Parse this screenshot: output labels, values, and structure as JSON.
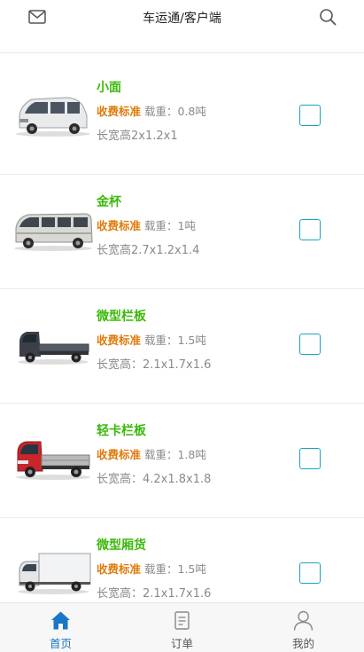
{
  "header": {
    "title": "车运通/客户端",
    "left_icon": "mail-icon",
    "right_icon": "search-icon"
  },
  "vehicles": [
    {
      "name": "小面",
      "fee_label": "收费标准",
      "load": "载重：0.8吨",
      "dims": "长宽高2x1.2x1"
    },
    {
      "name": "金杯",
      "fee_label": "收费标准",
      "load": "载重：1吨",
      "dims": "长宽高2.7x1.2x1.4"
    },
    {
      "name": "微型栏板",
      "fee_label": "收费标准",
      "load": "载重：1.5吨",
      "dims": "长宽高：2.1x1.7x1.6"
    },
    {
      "name": "轻卡栏板",
      "fee_label": "收费标准",
      "load": "载重：1.8吨",
      "dims": "长宽高：4.2x1.8x1.8"
    },
    {
      "name": "微型厢货",
      "fee_label": "收费标准",
      "load": "载重：1.5吨",
      "dims": "长宽高：2.1x1.7x1.6"
    }
  ],
  "tabs": [
    {
      "label": "首页",
      "icon": "home-icon",
      "active": true
    },
    {
      "label": "订单",
      "icon": "order-icon",
      "active": false
    },
    {
      "label": "我的",
      "icon": "user-icon",
      "active": false
    }
  ],
  "colors": {
    "accent": "#1977c6",
    "vehicle_name": "#3bb90a",
    "fee": "#e07a0b",
    "checkbox": "#19a3c7"
  }
}
